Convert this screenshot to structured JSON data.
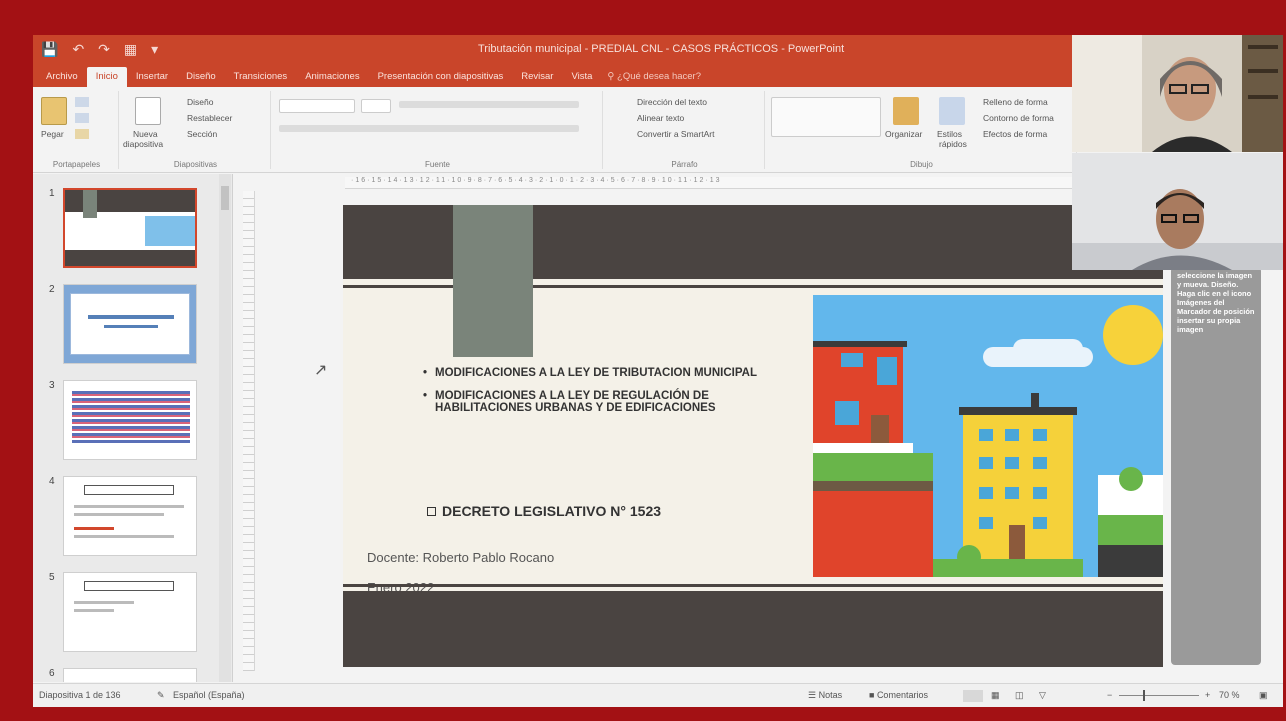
{
  "window": {
    "title": "Tributación municipal - PREDIAL CNL - CASOS PRÁCTICOS - PowerPoint"
  },
  "tabs": [
    "Archivo",
    "Inicio",
    "Insertar",
    "Diseño",
    "Transiciones",
    "Animaciones",
    "Presentación con diapositivas",
    "Revisar",
    "Vista"
  ],
  "tell_me": "¿Qué desea hacer?",
  "ribbon": {
    "clipboard": {
      "paste": "Pegar",
      "label": "Portapapeles"
    },
    "slides": {
      "new_slide_line1": "Nueva",
      "new_slide_line2": "diapositiva",
      "layout": "Diseño",
      "reset": "Restablecer",
      "section": "Sección",
      "label": "Diapositivas"
    },
    "font": {
      "label": "Fuente"
    },
    "paragraph": {
      "text_direction": "Dirección del texto",
      "align_text": "Alinear texto",
      "convert_smartart": "Convertir a SmartArt",
      "label": "Párrafo"
    },
    "drawing": {
      "arrange": "Organizar",
      "quick_styles_line1": "Estilos",
      "quick_styles_line2": "rápidos",
      "fill": "Relleno de forma",
      "outline": "Contorno de forma",
      "effects": "Efectos de forma",
      "label": "Dibujo"
    }
  },
  "thumbnails": [
    {
      "num": "1"
    },
    {
      "num": "2"
    },
    {
      "num": "3"
    },
    {
      "num": "4"
    },
    {
      "num": "5"
    },
    {
      "num": "6"
    }
  ],
  "ruler_text": "·16·15·14·13·12·11·10·9·8·7·6·5·4·3·2·1·0·1·2·3·4·5·6·7·8·9·10·11·12·13",
  "slide": {
    "bullets": [
      "MODIFICACIONES A LA LEY DE TRIBUTACION MUNICIPAL",
      "MODIFICACIONES A LA LEY DE REGULACIÓN DE HABILITACIONES URBANAS Y DE EDIFICACIONES"
    ],
    "decreto": "DECRETO LEGISLATIVO N° 1523",
    "docente": "Docente: Roberto Pablo Rocano",
    "fecha": "Enero 2022"
  },
  "side_pane": {
    "text": "seleccione la imagen y mueva. Diseño. Haga clic en el icono Imágenes del Marcador de posición insertar su propia imagen"
  },
  "status": {
    "slide_count": "Diapositiva 1 de 136",
    "language": "Español (España)",
    "notes": "Notas",
    "comments": "Comentarios",
    "zoom": "70 %",
    "zoom_level": 0.3
  },
  "colors": {
    "accent": "#c9452a",
    "border": "#a31114",
    "slide_dark": "#4a4441",
    "slide_bg": "#f4f1e8",
    "bookmark": "#7a847a"
  }
}
